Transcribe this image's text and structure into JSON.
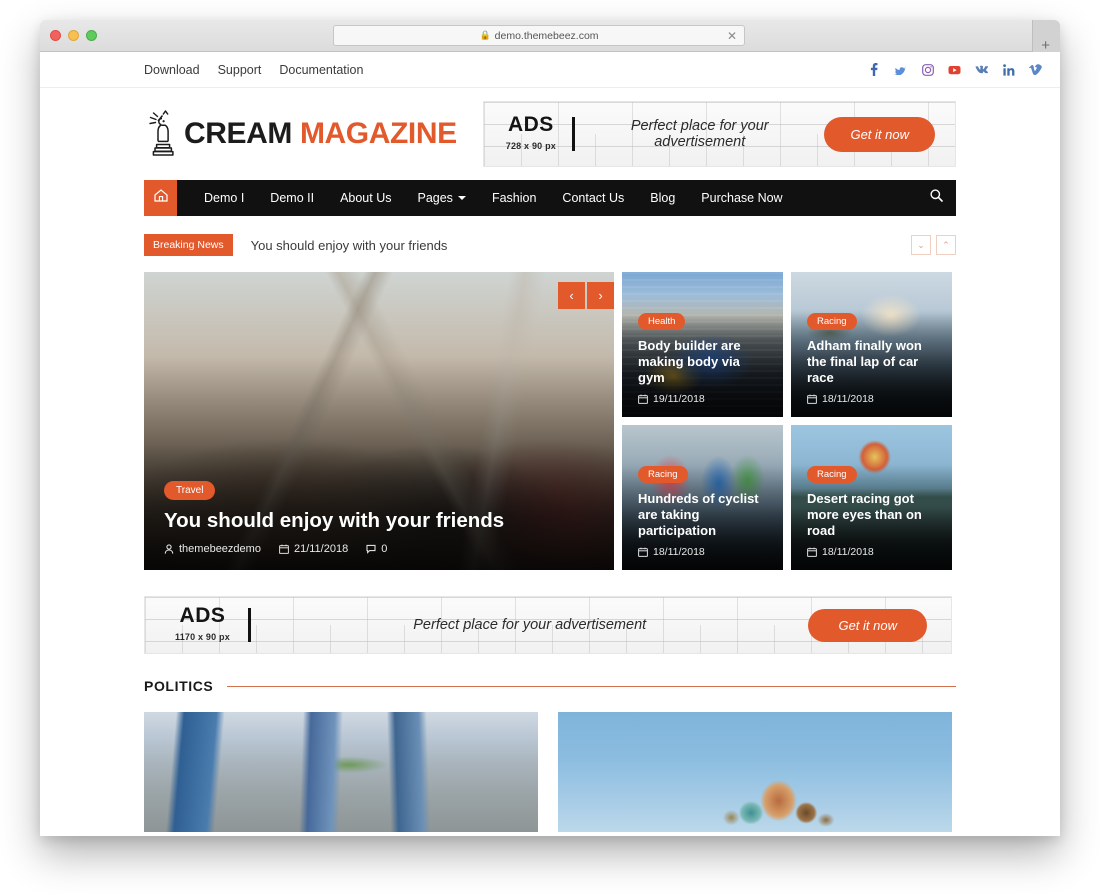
{
  "browser": {
    "url": "demo.themebeez.com",
    "lock_icon": "lock-icon",
    "stop_icon": "close-icon",
    "new_tab_icon": "plus-icon"
  },
  "topbar": {
    "links": [
      {
        "label": "Download"
      },
      {
        "label": "Support"
      },
      {
        "label": "Documentation"
      }
    ],
    "social": [
      {
        "name": "facebook-icon",
        "glyph": "f",
        "color": "#4267B2"
      },
      {
        "name": "twitter-icon",
        "glyph": "twitter",
        "color": "#5b8fd9"
      },
      {
        "name": "instagram-icon",
        "glyph": "instagram",
        "color": "#8a5fb5"
      },
      {
        "name": "youtube-icon",
        "glyph": "youtube",
        "color": "#e0422f"
      },
      {
        "name": "vk-icon",
        "glyph": "vk",
        "color": "#5a7fb5"
      },
      {
        "name": "linkedin-icon",
        "glyph": "in",
        "color": "#3f6fa8"
      },
      {
        "name": "vimeo-icon",
        "glyph": "V",
        "color": "#5b87c9"
      }
    ]
  },
  "brand": {
    "name_primary": "CREAM",
    "name_accent": "MAGAZINE",
    "accent_color": "#e2592c",
    "logo_icon": "statue-of-liberty-icon"
  },
  "ads": {
    "top": {
      "title": "ADS",
      "size": "728 x 90 px",
      "slogan": "Perfect place for your advertisement",
      "cta": "Get it now"
    },
    "wide": {
      "title": "ADS",
      "size": "1170 x 90 px",
      "slogan": "Perfect place for your advertisement",
      "cta": "Get it now"
    }
  },
  "nav": {
    "home_icon": "home-icon",
    "search_icon": "search-icon",
    "items": [
      {
        "label": "Demo I",
        "has_dropdown": false
      },
      {
        "label": "Demo II",
        "has_dropdown": false
      },
      {
        "label": "About Us",
        "has_dropdown": false
      },
      {
        "label": "Pages",
        "has_dropdown": true
      },
      {
        "label": "Fashion",
        "has_dropdown": false
      },
      {
        "label": "Contact Us",
        "has_dropdown": false
      },
      {
        "label": "Blog",
        "has_dropdown": false
      },
      {
        "label": "Purchase Now",
        "has_dropdown": false
      }
    ]
  },
  "breaking": {
    "badge": "Breaking News",
    "headline": "You should enjoy with your friends",
    "prev_icon": "chevron-down-icon",
    "next_icon": "chevron-up-icon",
    "prev_glyph": "⌄",
    "next_glyph": "⌃"
  },
  "hero": {
    "prev_glyph": "‹",
    "next_glyph": "›",
    "featured": {
      "category": "Travel",
      "title": "You should enjoy with your friends",
      "author": "themebeezdemo",
      "date": "21/11/2018",
      "comments": "0",
      "author_icon": "user-icon",
      "date_icon": "calendar-icon",
      "comment_icon": "comment-icon"
    },
    "cards": [
      {
        "category": "Health",
        "title": "Body builder are making body via gym",
        "date": "19/11/2018",
        "image_class": "img-race"
      },
      {
        "category": "Racing",
        "title": "Adham finally won the final lap of car race",
        "date": "18/11/2018",
        "image_class": "img-sea"
      },
      {
        "category": "Racing",
        "title": "Hundreds of cyclist are taking participation",
        "date": "18/11/2018",
        "image_class": "img-cycle"
      },
      {
        "category": "Racing",
        "title": "Desert racing got more eyes than on road",
        "date": "18/11/2018",
        "image_class": "img-balloon"
      }
    ]
  },
  "politics": {
    "section_title": "POLITICS",
    "rule_color": "#d1714e",
    "cards": [
      {
        "image_class": "img-city"
      },
      {
        "image_class": "img-kremlin"
      }
    ]
  }
}
